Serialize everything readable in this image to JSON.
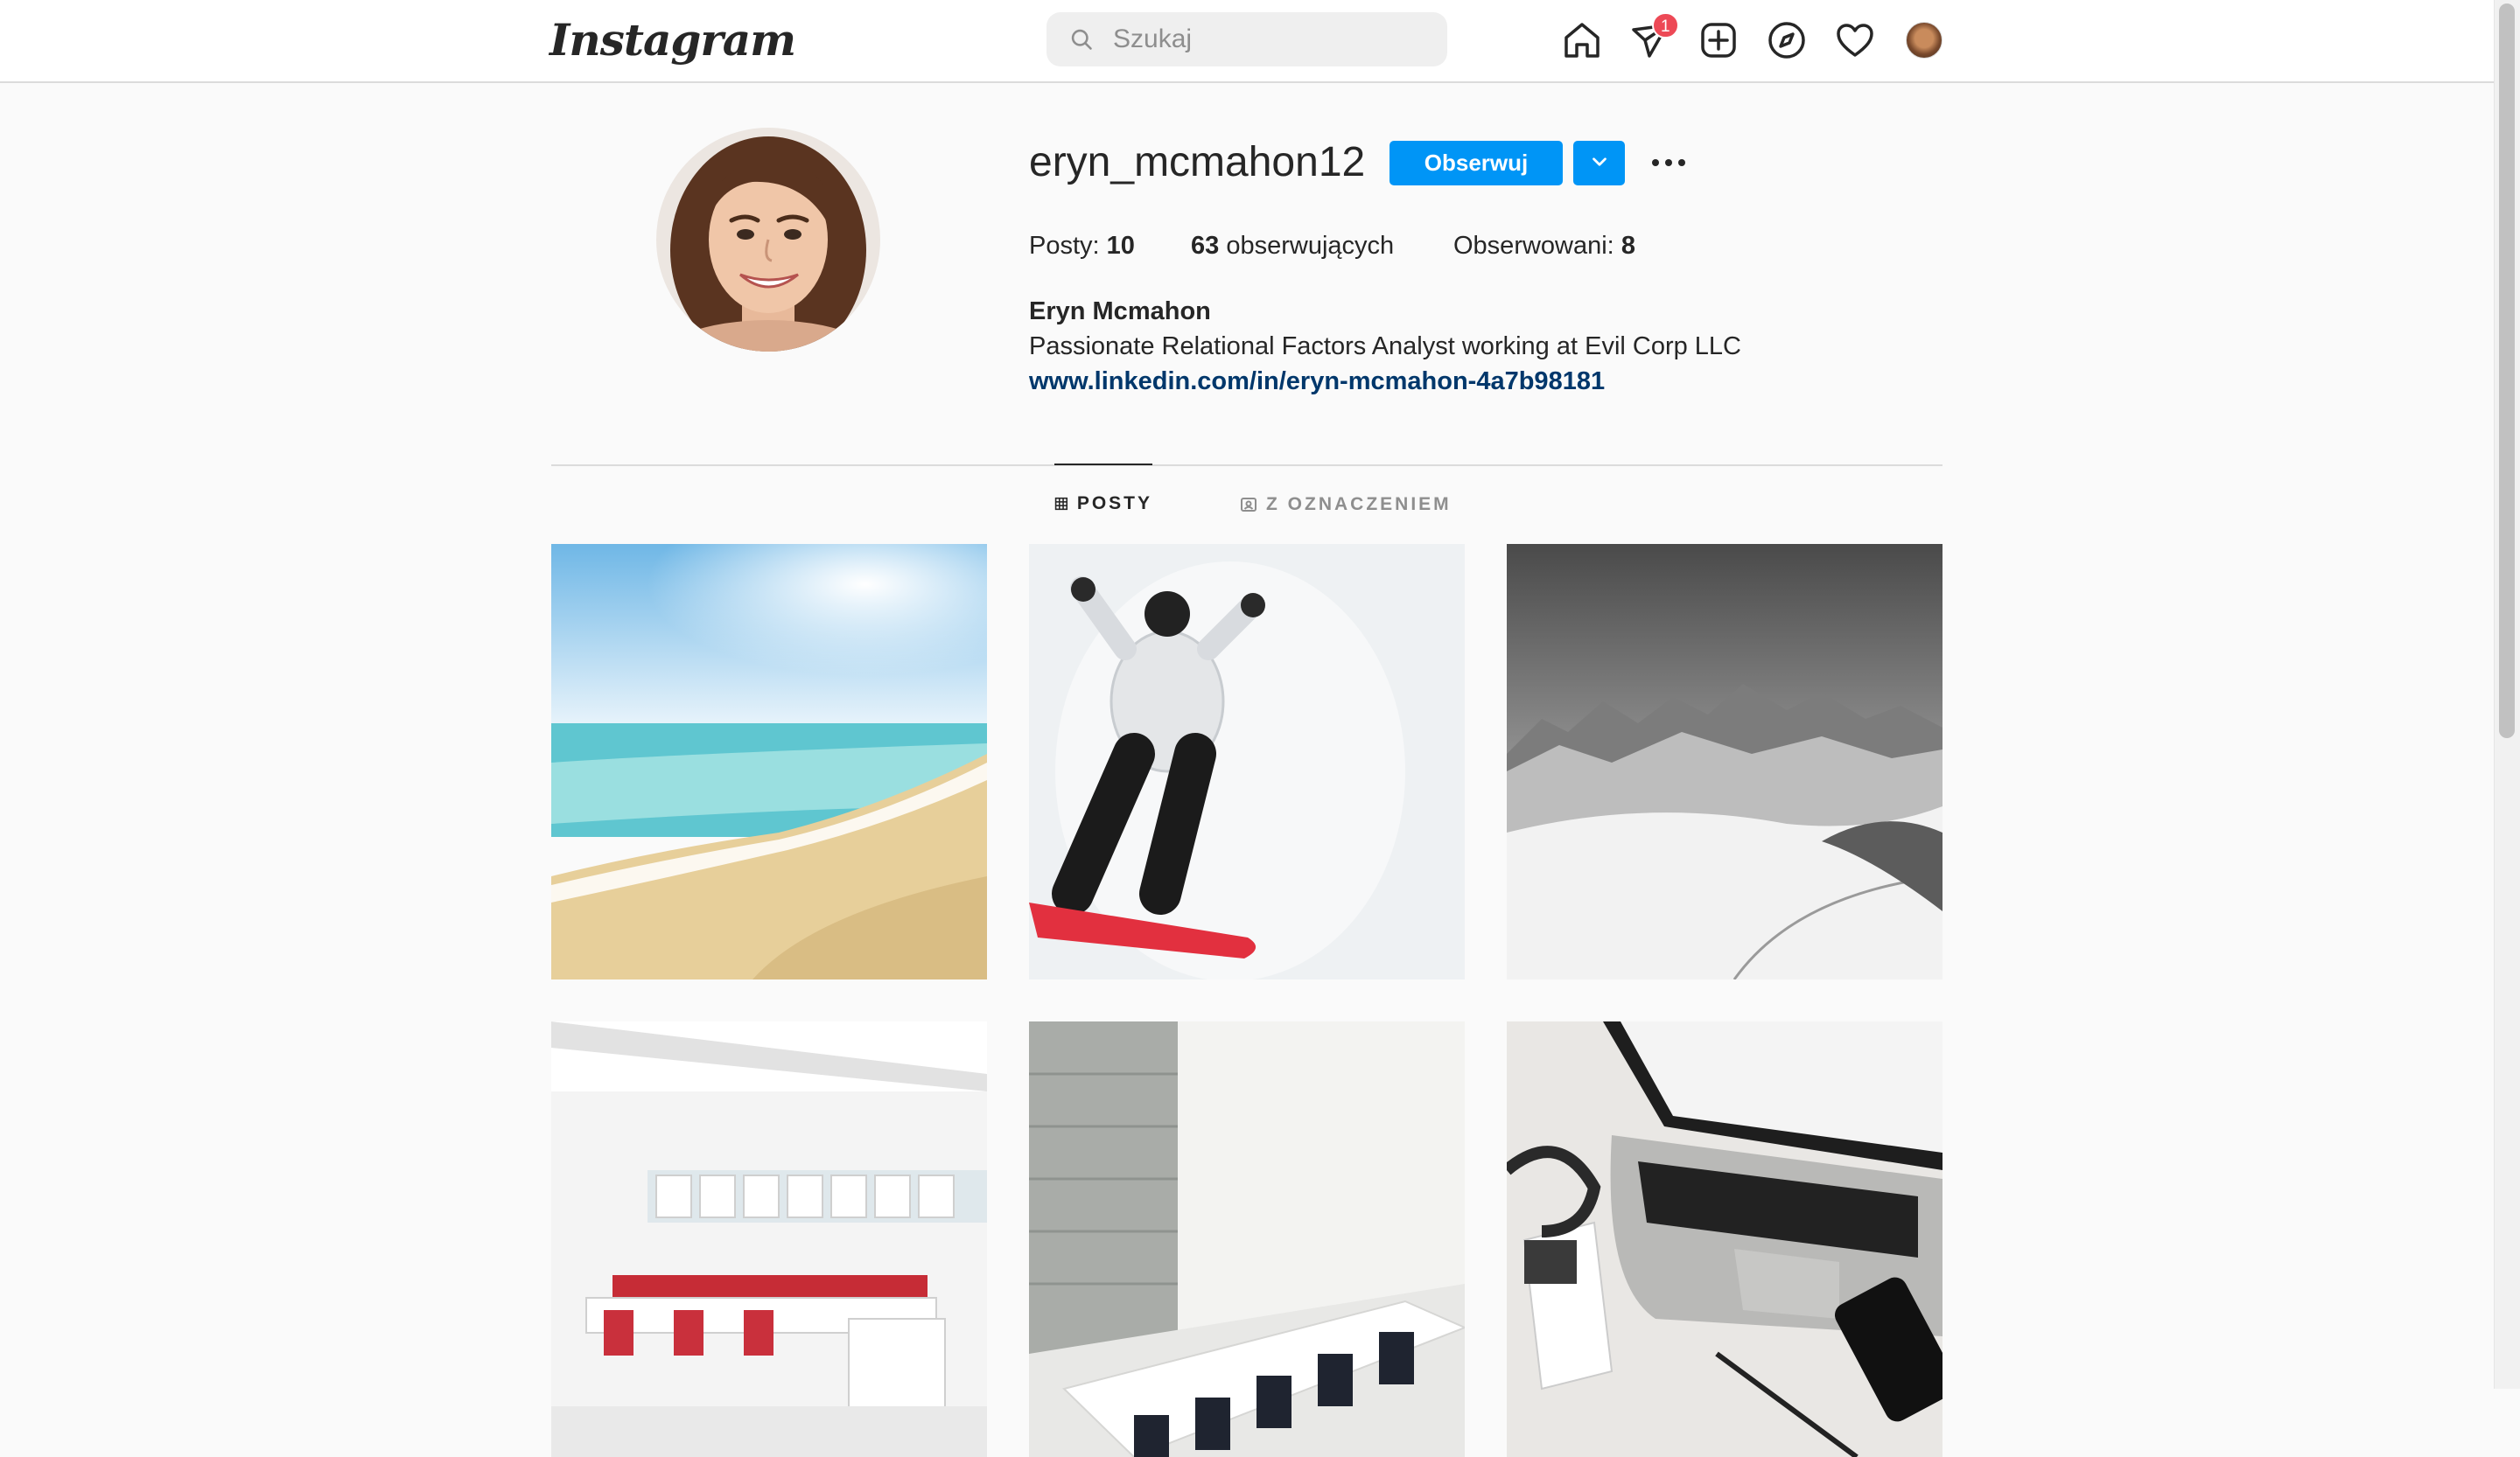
{
  "topbar": {
    "logo": "Instagram",
    "search_placeholder": "Szukaj",
    "messages_badge": "1"
  },
  "profile": {
    "username": "eryn_mcmahon12",
    "follow_label": "Obserwuj",
    "posts_label": "Posty:",
    "posts_count": "10",
    "followers_count": "63",
    "followers_label": "obserwujących",
    "following_label": "Obserwowani:",
    "following_count": "8",
    "full_name": "Eryn Mcmahon",
    "bio": "Passionate Relational Factors Analyst working at Evil Corp LLC",
    "link": "www.linkedin.com/in/eryn-mcmahon-4a7b98181"
  },
  "tabs": [
    {
      "label": "POSTY",
      "active": true
    },
    {
      "label": "Z OZNACZENIEM",
      "active": false
    }
  ],
  "colors": {
    "accent": "#0095f6",
    "badge": "#ed4956",
    "link": "#00376b"
  },
  "icons": [
    "search-icon",
    "home-icon",
    "messages-icon",
    "new-post-icon",
    "explore-icon",
    "activity-heart-icon",
    "grid-icon",
    "tagged-icon",
    "chevron-down-icon",
    "more-icon"
  ]
}
